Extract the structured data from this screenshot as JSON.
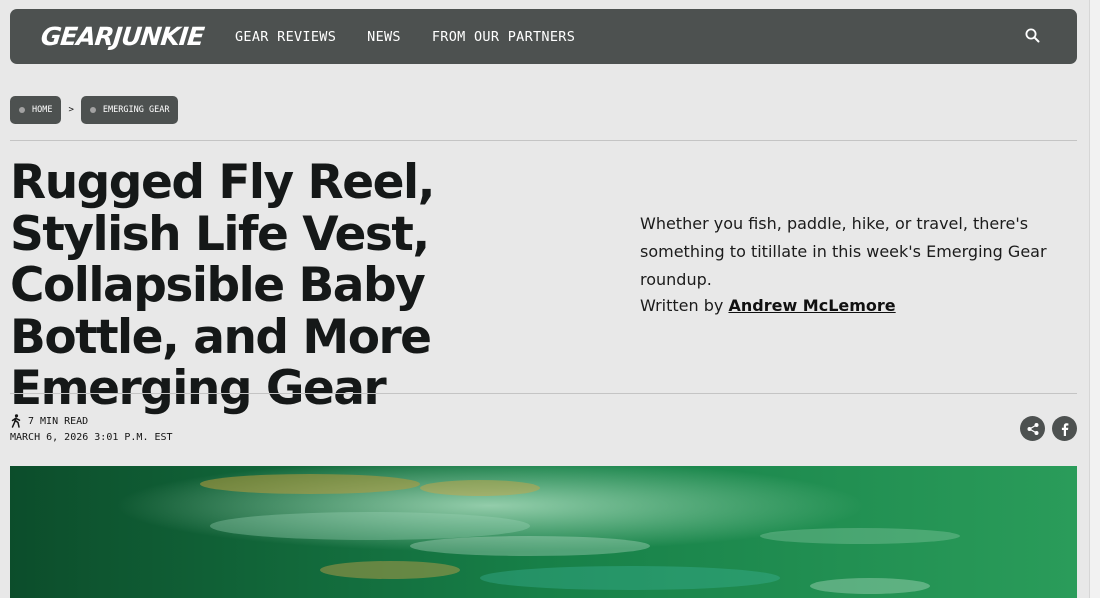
{
  "header": {
    "logo": "GEARJUNKIE",
    "nav": [
      "GEAR REVIEWS",
      "NEWS",
      "FROM OUR PARTNERS"
    ]
  },
  "breadcrumb": {
    "items": [
      "HOME",
      "EMERGING GEAR"
    ],
    "separator": ">"
  },
  "article": {
    "title": "Rugged Fly Reel, Stylish Life Vest, Collapsible Baby Bottle, and More Emerging Gear",
    "dek": "Whether you fish, paddle, hike, or travel, there's something to titillate in this week's Emerging Gear roundup.",
    "byline_prefix": "Written by",
    "author": "Andrew McLemore",
    "read_time": "7 MIN READ",
    "date": "MARCH 6, 2026 3:01 P.M. EST"
  },
  "colors": {
    "header_bg": "#4d5150",
    "page_bg": "#e8e8e8",
    "hero_green": "#1d8a4e"
  },
  "icons": [
    "search-icon",
    "walking-person-icon",
    "share-icon",
    "facebook-icon"
  ]
}
